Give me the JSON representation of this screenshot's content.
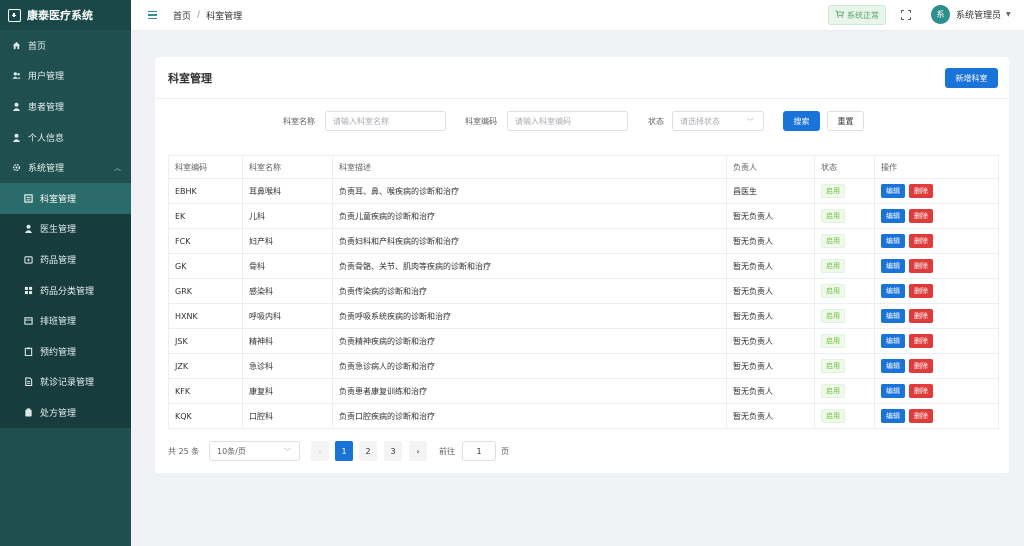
{
  "app": {
    "title": "康泰医疗系统"
  },
  "sidebar": {
    "items": [
      {
        "label": "首页",
        "icon": "home-icon"
      },
      {
        "label": "用户管理",
        "icon": "users-icon"
      },
      {
        "label": "患者管理",
        "icon": "patient-icon"
      },
      {
        "label": "个人信息",
        "icon": "user-icon"
      },
      {
        "label": "系统管理",
        "icon": "gear-icon"
      }
    ],
    "subitems": [
      {
        "label": "科室管理",
        "icon": "building-icon",
        "active": true
      },
      {
        "label": "医生管理",
        "icon": "doctor-icon"
      },
      {
        "label": "药品管理",
        "icon": "medicine-box-icon"
      },
      {
        "label": "药品分类管理",
        "icon": "grid-icon"
      },
      {
        "label": "排班管理",
        "icon": "calendar-icon"
      },
      {
        "label": "预约管理",
        "icon": "clipboard-icon"
      },
      {
        "label": "就诊记录管理",
        "icon": "document-icon"
      },
      {
        "label": "处方管理",
        "icon": "prescription-icon"
      }
    ]
  },
  "header": {
    "breadcrumb": [
      "首页",
      "科室管理"
    ],
    "breadcrumb_sep": "/",
    "status": "系统正常",
    "user": {
      "name": "系统管理员",
      "avatar_text": "系"
    }
  },
  "page": {
    "title": "科室管理",
    "new_button": "新增科室"
  },
  "search": {
    "name_label": "科室名称",
    "name_placeholder": "请输入科室名称",
    "code_label": "科室编码",
    "code_placeholder": "请输入科室编码",
    "status_label": "状态",
    "status_placeholder": "请选择状态",
    "search_button": "搜索",
    "reset_button": "重置"
  },
  "table": {
    "columns": [
      "科室编码",
      "科室名称",
      "科室描述",
      "负责人",
      "状态",
      "操作"
    ],
    "edit_label": "编辑",
    "delete_label": "删除",
    "rows": [
      {
        "code": "EBHK",
        "name": "耳鼻喉科",
        "desc": "负责耳、鼻、喉疾病的诊断和治疗",
        "head": "昌医生",
        "status": "启用"
      },
      {
        "code": "EK",
        "name": "儿科",
        "desc": "负责儿童疾病的诊断和治疗",
        "head": "暂无负责人",
        "status": "启用"
      },
      {
        "code": "FCK",
        "name": "妇产科",
        "desc": "负责妇科和产科疾病的诊断和治疗",
        "head": "暂无负责人",
        "status": "启用"
      },
      {
        "code": "GK",
        "name": "骨科",
        "desc": "负责骨骼、关节、肌肉等疾病的诊断和治疗",
        "head": "暂无负责人",
        "status": "启用"
      },
      {
        "code": "GRK",
        "name": "感染科",
        "desc": "负责传染病的诊断和治疗",
        "head": "暂无负责人",
        "status": "启用"
      },
      {
        "code": "HXNK",
        "name": "呼吸内科",
        "desc": "负责呼吸系统疾病的诊断和治疗",
        "head": "暂无负责人",
        "status": "启用"
      },
      {
        "code": "JSK",
        "name": "精神科",
        "desc": "负责精神疾病的诊断和治疗",
        "head": "暂无负责人",
        "status": "启用"
      },
      {
        "code": "JZK",
        "name": "急诊科",
        "desc": "负责急诊病人的诊断和治疗",
        "head": "暂无负责人",
        "status": "启用"
      },
      {
        "code": "KFK",
        "name": "康复科",
        "desc": "负责患者康复训练和治疗",
        "head": "暂无负责人",
        "status": "启用"
      },
      {
        "code": "KQK",
        "name": "口腔科",
        "desc": "负责口腔疾病的诊断和治疗",
        "head": "暂无负责人",
        "status": "启用"
      }
    ]
  },
  "pagination": {
    "total_text": "共 25 条",
    "page_size": "10条/页",
    "pages": [
      "1",
      "2",
      "3"
    ],
    "current": "1",
    "goto_label": "前往",
    "goto_value": "1",
    "goto_suffix": "页"
  },
  "colors": {
    "sidebar": "#1f4f4f",
    "primary": "#1a73d9",
    "danger": "#e03b3b",
    "success": "#67c23a"
  }
}
